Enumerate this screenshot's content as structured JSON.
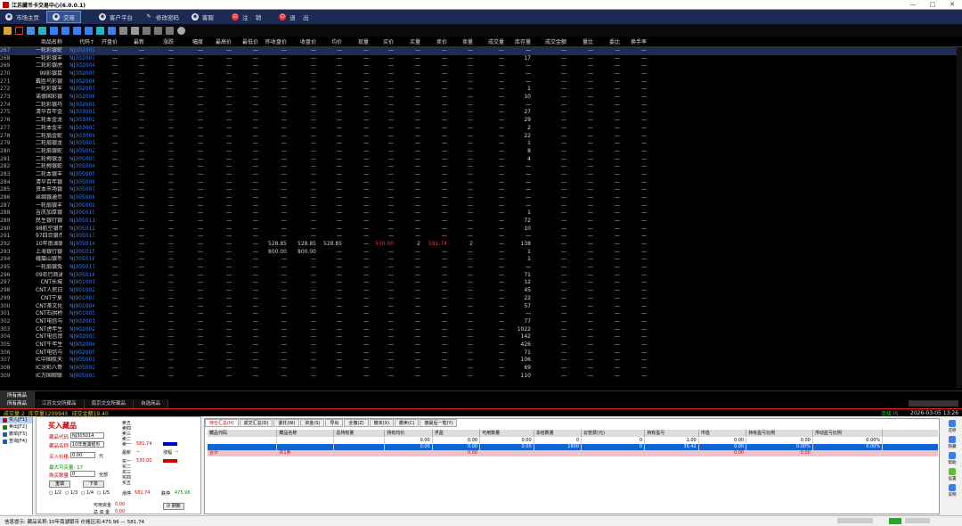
{
  "window": {
    "title": "江苏藏币卡交易中心(6.0.0.1)",
    "controls": [
      "—",
      "□",
      "✕"
    ]
  },
  "menu": [
    {
      "label": "市场主页",
      "icon": "globe-icon",
      "active": false
    },
    {
      "label": "交易",
      "icon": "globe-icon",
      "active": true
    },
    {
      "label": "客户平台",
      "icon": "globe-icon",
      "active": false
    },
    {
      "label": "修改密码",
      "icon": "pencil-icon",
      "active": false
    },
    {
      "label": "客服",
      "icon": "globe-icon",
      "active": false
    },
    {
      "label": "注    销",
      "icon": "power-icon",
      "active": false
    },
    {
      "label": "退    出",
      "icon": "power-icon",
      "active": false
    }
  ],
  "grid": {
    "columns": [
      "商品名称",
      "代码↑",
      "开盘价",
      "最新",
      "涨跌",
      "幅度",
      "最高价",
      "最低价",
      "昨收盘价",
      "收盘价",
      "均价",
      "现量",
      "买价",
      "买量",
      "卖价",
      "卖量",
      "成交量",
      "库存量",
      "成交金额",
      "量比",
      "委比",
      "换手率"
    ],
    "rows": [
      {
        "no": "267",
        "name": "一轮彩银蛇",
        "code": "NJ302002",
        "stock": "—",
        "sel": true
      },
      {
        "no": "268",
        "name": "一轮彩银羊",
        "code": "NJ302003",
        "stock": "17"
      },
      {
        "no": "269",
        "name": "二轮彩银虎",
        "code": "NJ302004",
        "stock": "—"
      },
      {
        "no": "270",
        "name": "99彩银鼠",
        "code": "NJ302005",
        "stock": "—"
      },
      {
        "no": "271",
        "name": "戴胜鸟彩银币",
        "code": "NJ302006",
        "stock": "—"
      },
      {
        "no": "272",
        "name": "一轮彩银羊",
        "code": "NJ302007",
        "stock": "1"
      },
      {
        "no": "273",
        "name": "诺德国彩银币",
        "code": "NJ302008",
        "stock": "10"
      },
      {
        "no": "274",
        "name": "二轮彩银马",
        "code": "NJ302009",
        "stock": "—"
      },
      {
        "no": "275",
        "name": "清华百年金币",
        "code": "NJ303001",
        "stock": "27"
      },
      {
        "no": "276",
        "name": "二轮本金龙",
        "code": "NJ303002",
        "stock": "29"
      },
      {
        "no": "277",
        "name": "二轮本金羊",
        "code": "NJ303003",
        "stock": "2"
      },
      {
        "no": "278",
        "name": "二轮扇金蛇",
        "code": "NJ303004",
        "stock": "22"
      },
      {
        "no": "279",
        "name": "二轮扇银龙",
        "code": "NJ305001",
        "stock": "1"
      },
      {
        "no": "280",
        "name": "二轮扇银蛇",
        "code": "NJ305002",
        "stock": "8"
      },
      {
        "no": "281",
        "name": "二轮梅银龙",
        "code": "NJ305003",
        "stock": "4"
      },
      {
        "no": "282",
        "name": "二轮梅银蛇",
        "code": "NJ305004",
        "stock": "—"
      },
      {
        "no": "283",
        "name": "二轮本银羊",
        "code": "NJ305005",
        "stock": "—"
      },
      {
        "no": "284",
        "name": "清华百年银币",
        "code": "NJ305006",
        "stock": "—"
      },
      {
        "no": "285",
        "name": "资本市场银币",
        "code": "NJ305007",
        "stock": "—"
      },
      {
        "no": "286",
        "name": "丝绸银通币",
        "code": "NJ305008",
        "stock": "—"
      },
      {
        "no": "287",
        "name": "一轮扇银羊",
        "code": "NJ305009",
        "stock": "—"
      },
      {
        "no": "288",
        "name": "吉庆加厚银币",
        "code": "NJ305010",
        "stock": "1"
      },
      {
        "no": "289",
        "name": "民生银行银币",
        "code": "NJ305011",
        "stock": "72"
      },
      {
        "no": "290",
        "name": "98航空银币",
        "code": "NJ305012",
        "stock": "10"
      },
      {
        "no": "291",
        "name": "97四合银币",
        "code": "NJ305013",
        "stock": "—"
      },
      {
        "no": "292",
        "name": "10年南湖银币",
        "code": "NJ305014",
        "prev": "528.85",
        "close": "528.85",
        "avg": "528.85",
        "bid": "530.00",
        "bidq": "2",
        "ask": "581.74",
        "askq": "2",
        "stock": "138"
      },
      {
        "no": "293",
        "name": "上海银行银币",
        "code": "NJ305015",
        "prev": "800.00",
        "close": "800.00",
        "stock": "1"
      },
      {
        "no": "294",
        "name": "峨眉山银币",
        "code": "NJ305016",
        "stock": "1"
      },
      {
        "no": "295",
        "name": "一轮扇银兔",
        "code": "NJ305017",
        "stock": "—"
      },
      {
        "no": "296",
        "name": "09农行商通银币",
        "code": "NJ305018",
        "stock": "71"
      },
      {
        "no": "297",
        "name": "CNT长城",
        "code": "NJ901001",
        "stock": "12"
      },
      {
        "no": "298",
        "name": "CNT人民日报",
        "code": "NJ901002",
        "stock": "45"
      },
      {
        "no": "299",
        "name": "CNT宁夏",
        "code": "NJ901003",
        "stock": "22"
      },
      {
        "no": "300",
        "name": "CNT茶文化",
        "code": "NJ901004",
        "stock": "57"
      },
      {
        "no": "301",
        "name": "CNT石拱桥",
        "code": "NJ901005",
        "stock": "—"
      },
      {
        "no": "302",
        "name": "CNT电信与人通",
        "code": "NJ902001",
        "stock": "77"
      },
      {
        "no": "303",
        "name": "CNT虎年生肖",
        "code": "NJ902002",
        "stock": "1022"
      },
      {
        "no": "304",
        "name": "CNT电信贸易",
        "code": "NJ902003",
        "stock": "142"
      },
      {
        "no": "305",
        "name": "CNT牛年生肖",
        "code": "NJ902004",
        "stock": "426"
      },
      {
        "no": "306",
        "name": "CNT电信与体育",
        "code": "NJ902005",
        "stock": "71"
      },
      {
        "no": "307",
        "name": "IC中国航天",
        "code": "NJ905001",
        "stock": "106"
      },
      {
        "no": "308",
        "name": "IC汾彩八哥",
        "code": "NJ905002",
        "stock": "69"
      },
      {
        "no": "309",
        "name": "IC万国邮联",
        "code": "NJ905003",
        "stock": "110"
      }
    ]
  },
  "tabs_top": [
    "所有商品"
  ],
  "tabs_bottom": [
    "所有商品",
    "江苏文交所藏品",
    "南京文交所藏品",
    "自选商品"
  ],
  "status": {
    "volume": "成交量:2",
    "stock": "库存量1209945",
    "amount": "成交金额19.40",
    "connection": "连接  IS",
    "time": "2026-03-05 13:26"
  },
  "leftnav": [
    "买入[F1]",
    "卖出[F2]",
    "撤单[F3]",
    "查询[F4]"
  ],
  "buyform": {
    "title": "买入藏品",
    "code_label": "藏品代码",
    "code_value": "NJ305014",
    "name_label": "藏品名称",
    "name_value": "10年南湖银币",
    "price_label": "买入价格",
    "price_value": "0.00",
    "price_unit": "元",
    "max_label": "最大可买量: 17",
    "qty_label": "购买数量",
    "qty_value": "0",
    "qty_all": "全部",
    "reset": "重填",
    "submit": "下单",
    "fractions": [
      "1/2",
      "1/3",
      "1/4",
      "1/5"
    ],
    "fund_label": "可用资金",
    "fund_value": "0.00",
    "avail_label": "可用资金",
    "avail_value": "0.00",
    "hold_label": "持有市值",
    "hold_value": "0.00",
    "total_label": "总 资 金",
    "total_value": "0.00",
    "refresh": "刷新"
  },
  "quotes": {
    "sells": [
      "卖五",
      "卖四",
      "卖三",
      "卖二",
      "卖一"
    ],
    "sell1_price": "581.74",
    "latest": "最新",
    "latest_val": "--",
    "change": "涨幅",
    "change_val": "--",
    "buys": [
      "买一",
      "买二",
      "买三",
      "买四",
      "买五"
    ],
    "buy1_price": "530.00",
    "limit_up": "涨停",
    "limit_up_val": "581.74",
    "limit_down": "跌停",
    "limit_down_val": "475.96"
  },
  "orders": {
    "tabs": [
      "持仓汇总(H)",
      "成交汇总(D)",
      "委托(W)",
      "资金(S)",
      "导出",
      "全撤(Z)",
      "撤买(X)",
      "撤卖(C)",
      "撤最后一笔(Y)"
    ],
    "columns": [
      "藏品代码",
      "藏品名称",
      "总持有量",
      "持有均价",
      "浮盈",
      "可用数量",
      "冻结数量",
      "云管费(元)",
      "持有盈亏",
      "市值",
      "持有盈亏比例",
      "浮动盈亏比例"
    ],
    "rows": [
      {
        "cells": [
          "",
          "",
          "",
          "0.00",
          "0.00",
          "0.00",
          "0",
          "0",
          "1.00",
          "0.00",
          "0.00",
          "0.00%"
        ],
        "sel": false
      },
      {
        "cells": [
          "",
          "",
          "",
          "0.00",
          "0.00",
          "0.00",
          "1800",
          "0",
          "36.42",
          "0.00",
          "0.00%",
          "0.00%"
        ],
        "sel": true
      },
      {
        "cells": [
          "合计",
          "共1条",
          "",
          "",
          "0.00",
          "",
          "",
          "",
          "",
          "0.00",
          "0.00",
          ""
        ],
        "pink": true
      }
    ]
  },
  "rightbar": [
    "还原",
    "隐藏",
    "帮助",
    "设置",
    "说明"
  ],
  "footer": {
    "left": "信息提示:  藏品名称:10年南湖银币   价格区间:475.96 — 581.74"
  },
  "colors": {
    "menu_bg": "#1c2a54",
    "code": "#3a7ff2",
    "red": "#e33",
    "yellow": "#ddc23b"
  }
}
